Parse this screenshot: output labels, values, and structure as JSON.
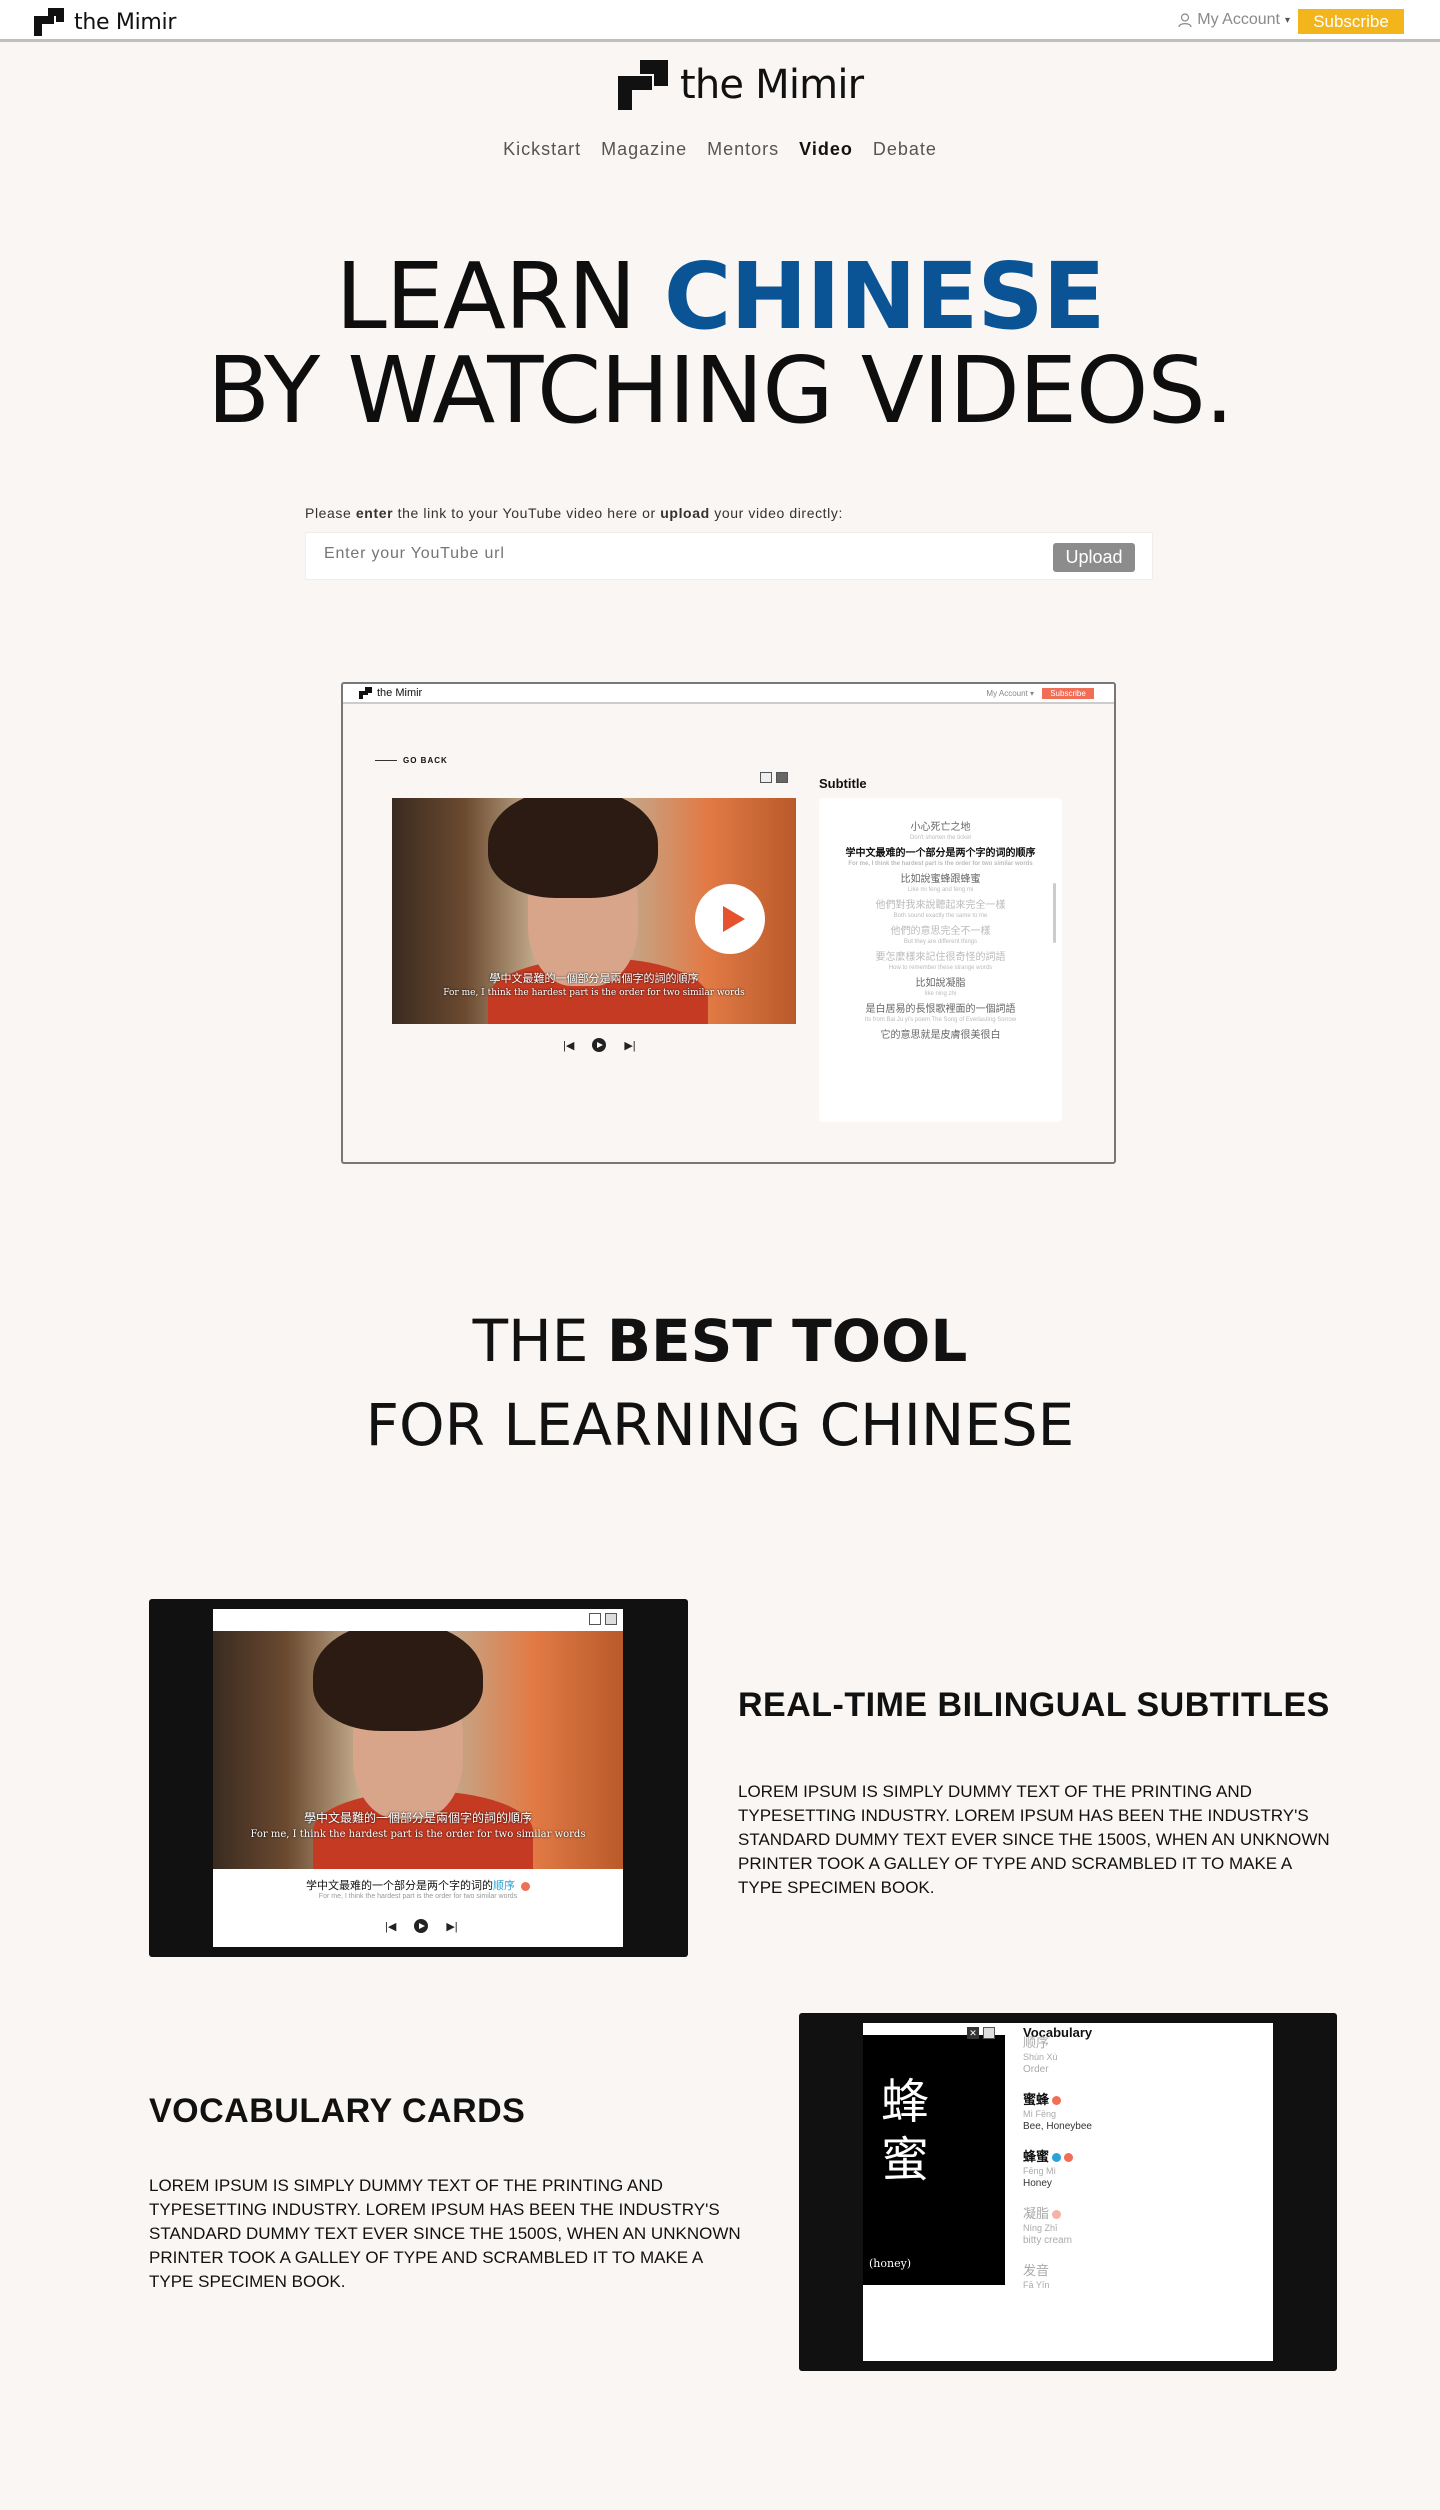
{
  "topbar": {
    "brand": "the Mimir",
    "account_label": "My Account",
    "account_caret": "▾",
    "subscribe_label": "Subscribe"
  },
  "header": {
    "brand": "the Mimir",
    "nav": [
      "Kickstart",
      "Magazine",
      "Mentors",
      "Video",
      "Debate"
    ],
    "active_nav": "Video"
  },
  "hero": {
    "line1_a": "LEARN",
    "line1_b": "CHINESE",
    "line2": "BY WATCHING VIDEOS."
  },
  "upload": {
    "prompt_pre": "Please",
    "prompt_enter": "enter",
    "prompt_mid": "the link to your YouTube video here or",
    "prompt_upload": "upload",
    "prompt_post": "your video directly:",
    "placeholder": "Enter your YouTube url",
    "button_label": "Upload"
  },
  "demo": {
    "brand": "the Mimir",
    "account_label": "My Account ▾",
    "subscribe_label": "Subscribe",
    "go_back": "GO BACK",
    "subtitle_heading": "Subtitle",
    "video_sub_cn": "學中文最難的一個部分是兩個字的詞的順序",
    "video_sub_en": "For me, I think the hardest part is the order for two similar words",
    "subtitle_lines": [
      {
        "cn": "小心死亡之地",
        "py": "Don't shorten the ticket",
        "state": "normal"
      },
      {
        "cn": "学中文最难的一个部分是两个字的词的顺序",
        "py": "For me, I think the hardest part is the order for two similar words",
        "state": "hi"
      },
      {
        "cn": "比如說蜜蜂跟蜂蜜",
        "py": "Like mi feng and feng mi",
        "state": "normal"
      },
      {
        "cn": "他們對我來說聽起來完全一樣",
        "py": "Both sound exactly the same to me",
        "state": "faded"
      },
      {
        "cn": "他們的意思完全不一樣",
        "py": "But they are different things",
        "state": "faded"
      },
      {
        "cn": "要怎麼樣來記住很奇怪的詞語",
        "py": "How to remember these strange words",
        "state": "faded"
      },
      {
        "cn": "比如說凝脂",
        "py": "like ning zhi",
        "state": "normal"
      },
      {
        "cn": "是白居易的長恨歌裡面的一個詞語",
        "py": "Its from Bai Ju yi's poem The Song of Everlasting Sorrow",
        "state": "normal"
      },
      {
        "cn": "它的意思就是皮膚很美很白",
        "py": "",
        "state": "normal"
      }
    ]
  },
  "best_tool": {
    "l1_pre": "THE",
    "l1_bold": "BEST TOOL",
    "l2": "FOR LEARNING CHINESE"
  },
  "feature1": {
    "title": "REAL-TIME BILINGUAL SUBTITLES",
    "body": "LOREM IPSUM IS SIMPLY DUMMY TEXT OF THE PRINTING AND TYPESETTING INDUSTRY. LOREM IPSUM HAS BEEN THE INDUSTRY'S STANDARD DUMMY TEXT EVER SINCE THE 1500S, WHEN AN UNKNOWN PRINTER TOOK A GALLEY OF TYPE AND SCRAMBLED IT TO MAKE A TYPE SPECIMEN BOOK.",
    "video_sub_cn": "學中文最難的一個部分是兩個字的詞的順序",
    "video_sub_en": "For me, I think the hardest part is the order for two similar words",
    "caption_cn": "学中文最难的一个部分是两个字的词的",
    "caption_hl": "顺序",
    "caption_en": "For me, I think the hardest part is the order for two similar words"
  },
  "feature2": {
    "title": "VOCABULARY CARDS",
    "body": "LOREM IPSUM IS SIMPLY DUMMY TEXT OF THE PRINTING AND TYPESETTING INDUSTRY. LOREM IPSUM HAS BEEN THE INDUSTRY'S STANDARD DUMMY TEXT EVER SINCE THE 1500S, WHEN AN UNKNOWN PRINTER TOOK A GALLEY OF TYPE AND SCRAMBLED IT TO MAKE A TYPE SPECIMEN BOOK.",
    "card_char1": "蜂",
    "card_char2": "蜜",
    "card_caption": "(honey)",
    "vocab_heading": "Vocabulary",
    "vocab_items": [
      {
        "w": "顺序",
        "p": "Shùn Xù",
        "m": "Order",
        "state": "faded"
      },
      {
        "w": "蜜蜂",
        "p": "Mì Fēng",
        "m": "Bee, Honeybee",
        "state": "normal"
      },
      {
        "w": "蜂蜜",
        "p": "Fēng Mì",
        "m": "Honey",
        "state": "normal"
      },
      {
        "w": "凝脂",
        "p": "Níng Zhī",
        "m": "bitty cream",
        "state": "faded"
      },
      {
        "w": "发音",
        "p": "Fā Yīn",
        "m": "",
        "state": "faded"
      }
    ]
  },
  "colors": {
    "accent_blue": "#0a5495",
    "subscribe": "#f2b51c",
    "subscribe_demo": "#f06e55",
    "background": "#f9f6f3"
  }
}
